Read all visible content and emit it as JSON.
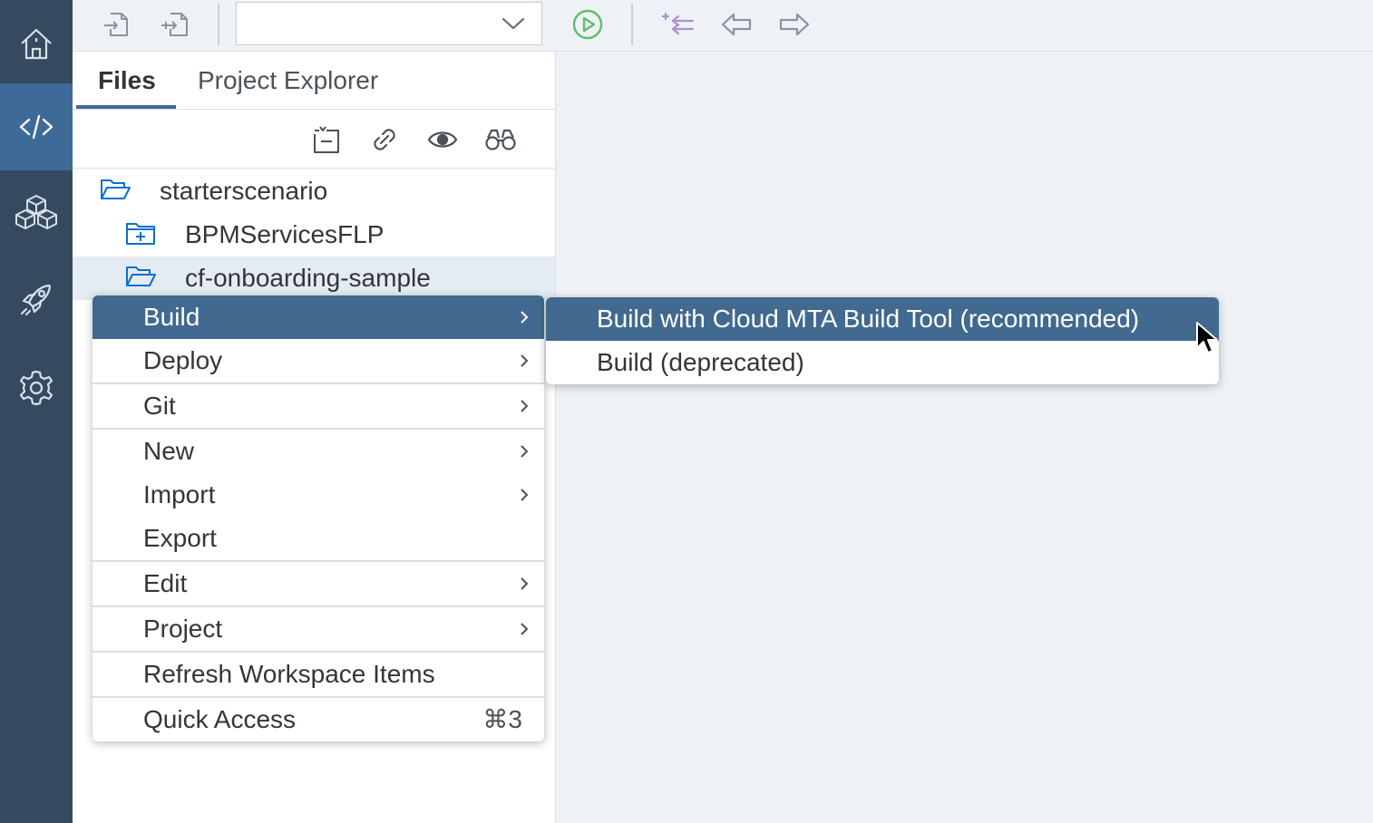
{
  "nav": {
    "items": [
      {
        "icon": "home-icon"
      },
      {
        "icon": "code-icon",
        "active": true
      },
      {
        "icon": "cubes-icon"
      },
      {
        "icon": "rocket-icon"
      },
      {
        "icon": "gear-icon"
      }
    ]
  },
  "toolbar": {
    "run_config_value": "",
    "icons": [
      "import-icon",
      "export-icon",
      "dropdown-chevron-icon",
      "run-icon",
      "compare-icon",
      "back-arrow-icon",
      "forward-arrow-icon"
    ],
    "run_color": "#5fbf68",
    "compare_color": "#b08ed0"
  },
  "panel": {
    "tabs": [
      {
        "label": "Files",
        "active": true
      },
      {
        "label": "Project Explorer",
        "active": false
      }
    ],
    "tools": [
      "collapse-all-icon",
      "link-icon",
      "eye-icon",
      "binoculars-icon"
    ],
    "tree": [
      {
        "label": "starterscenario",
        "icon": "folder-open-icon"
      },
      {
        "label": "BPMServicesFLP",
        "icon": "folder-plus-icon"
      },
      {
        "label": "cf-onboarding-sample",
        "icon": "folder-open-icon",
        "selected": true
      }
    ]
  },
  "context_menu": {
    "items": [
      {
        "label": "Build",
        "submenu": true,
        "highlighted": true
      },
      {
        "label": "Deploy",
        "submenu": true
      },
      {
        "label": "Git",
        "submenu": true
      },
      {
        "label": "New",
        "submenu": true
      },
      {
        "label": "Import",
        "submenu": true
      },
      {
        "label": "Export",
        "submenu": false
      },
      {
        "label": "Edit",
        "submenu": true
      },
      {
        "label": "Project",
        "submenu": true
      },
      {
        "label": "Refresh Workspace Items",
        "submenu": false
      },
      {
        "label": "Quick Access",
        "shortcut": "⌘3"
      }
    ]
  },
  "submenu": {
    "items": [
      {
        "label": "Build with Cloud MTA Build Tool (recommended)",
        "highlighted": true
      },
      {
        "label": "Build (deprecated)"
      }
    ]
  },
  "colors": {
    "nav_bg": "#354a5f",
    "nav_active": "#3d6a96",
    "menu_highlight": "#42698f",
    "workspace_bg": "#eef2f7"
  }
}
